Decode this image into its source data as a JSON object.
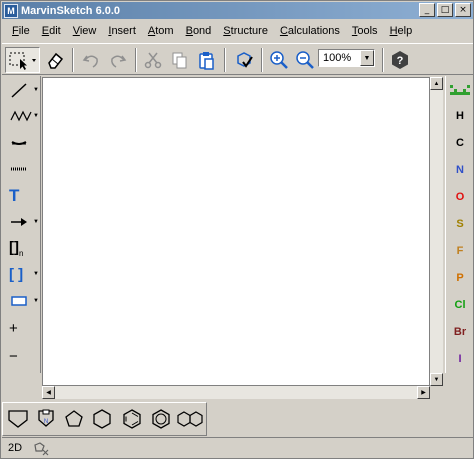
{
  "window": {
    "title": "MarvinSketch 6.0.0",
    "minimize": "_",
    "maximize": "□",
    "close": "×"
  },
  "menu": [
    {
      "first": "F",
      "rest": "ile"
    },
    {
      "first": "E",
      "rest": "dit"
    },
    {
      "first": "V",
      "rest": "iew"
    },
    {
      "first": "I",
      "rest": "nsert"
    },
    {
      "first": "A",
      "rest": "tom"
    },
    {
      "first": "B",
      "rest": "ond"
    },
    {
      "first": "S",
      "rest": "tructure"
    },
    {
      "first": "C",
      "rest": "alculations"
    },
    {
      "first": "T",
      "rest": "ools"
    },
    {
      "first": "H",
      "rest": "elp"
    }
  ],
  "toolbar": {
    "zoom_value": "100%"
  },
  "left_tools": {
    "text_tool": "T",
    "plus": "+",
    "minus": "−",
    "bracket_label": "[]",
    "bracket_sub": "n",
    "bracket2": "[ ]"
  },
  "elements": [
    {
      "symbol": "H",
      "color": "#000000"
    },
    {
      "symbol": "C",
      "color": "#000000"
    },
    {
      "symbol": "N",
      "color": "#3050c8"
    },
    {
      "symbol": "O",
      "color": "#e01010"
    },
    {
      "symbol": "S",
      "color": "#a08000"
    },
    {
      "symbol": "F",
      "color": "#c08020"
    },
    {
      "symbol": "P",
      "color": "#d07000"
    },
    {
      "symbol": "Cl",
      "color": "#10a010"
    },
    {
      "symbol": "Br",
      "color": "#802020"
    },
    {
      "symbol": "I",
      "color": "#7020a0"
    }
  ],
  "status": {
    "mode": "2D"
  },
  "colors": {
    "accent_blue": "#1a5fc8",
    "canvas": "#ffffff"
  }
}
